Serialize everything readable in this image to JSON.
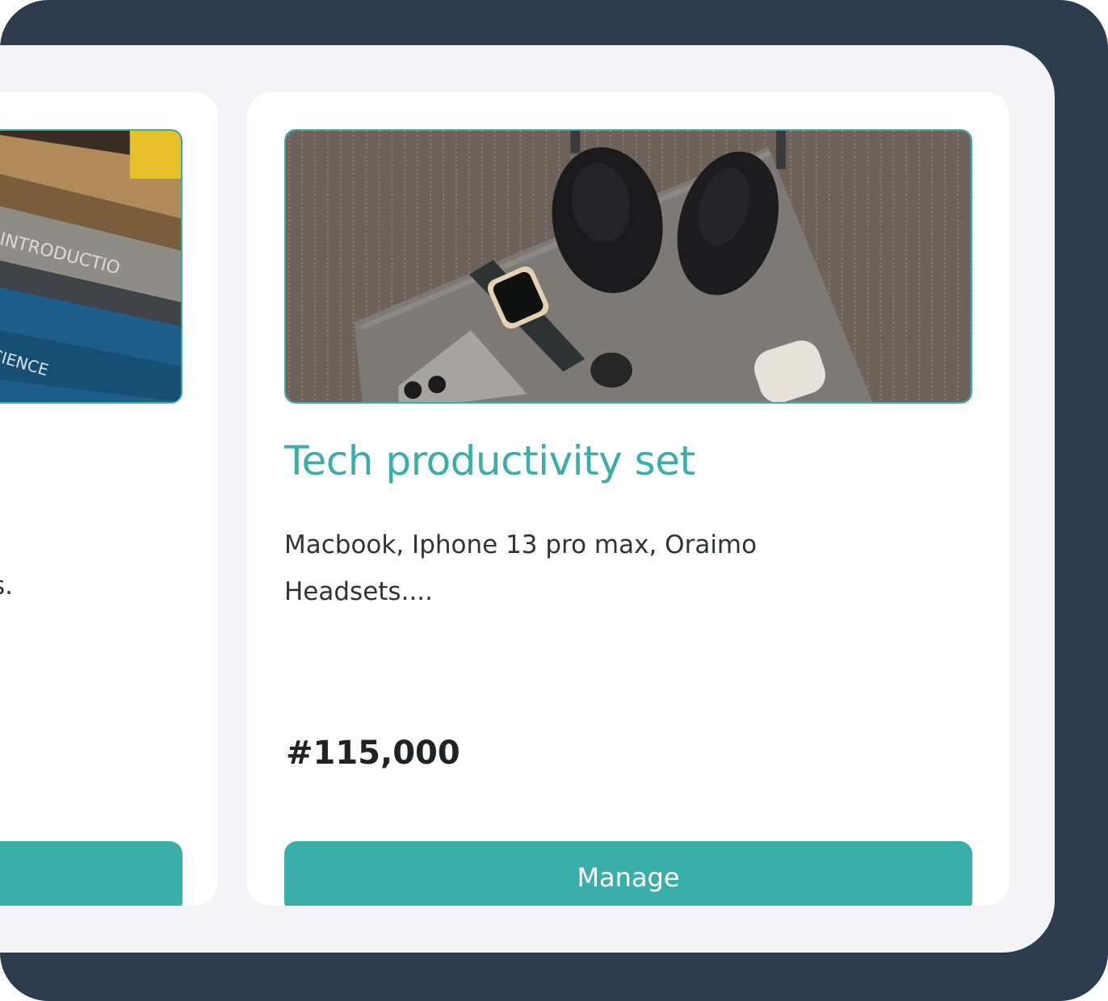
{
  "colors": {
    "frame": "#2d3b4f",
    "screen_bg": "#f4f4f7",
    "card_bg": "#ffffff",
    "accent": "#3aaea8",
    "text": "#2f3437",
    "price": "#1f2326"
  },
  "cards": [
    {
      "image_icon": "books-photo",
      "desc_fragment": "s.",
      "button_label": ""
    },
    {
      "image_icon": "tech-gadgets-photo",
      "title": "Tech productivity set",
      "description": "Macbook, Iphone 13 pro max, Oraimo Headsets....",
      "price": "#115,000",
      "button_label": "Manage"
    }
  ]
}
